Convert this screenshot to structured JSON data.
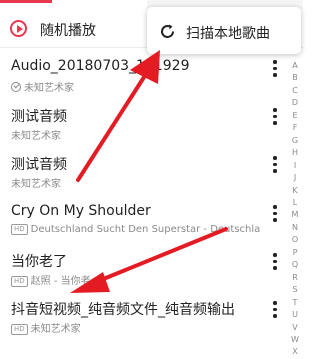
{
  "header": {
    "shuffle_label": "随机播放"
  },
  "popup_menu": {
    "scan_label": "扫描本地歌曲"
  },
  "songs": [
    {
      "title": "Audio_20180703_191929",
      "artist": "未知艺术家",
      "marker": "check-icon"
    },
    {
      "title": "测试音频",
      "artist": "未知艺术家",
      "marker": ""
    },
    {
      "title": "测试音频",
      "artist": "未知艺术家",
      "marker": ""
    },
    {
      "title": "Cry On My Shoulder",
      "artist": "Deutschland Sucht Den Superstar - Deutschla",
      "marker": "hd-badge"
    },
    {
      "title": "当你老了",
      "artist": "赵照 - 当你老",
      "marker": "hd-badge"
    },
    {
      "title": "抖音短视频_纯音频文件_纯音频输出",
      "artist": "未知艺术家",
      "marker": "hd-badge"
    }
  ],
  "badges": {
    "hd": "HD"
  },
  "alphabet_index": [
    "A",
    "B",
    "C",
    "D",
    "E",
    "F",
    "G",
    "H",
    "I",
    "J",
    "K",
    "L",
    "M",
    "N",
    "O",
    "P",
    "Q",
    "R",
    "S",
    "T",
    "U",
    "V",
    "W",
    "X"
  ],
  "colors": {
    "accent": "#e8384f",
    "arrow": "#e41b23"
  }
}
